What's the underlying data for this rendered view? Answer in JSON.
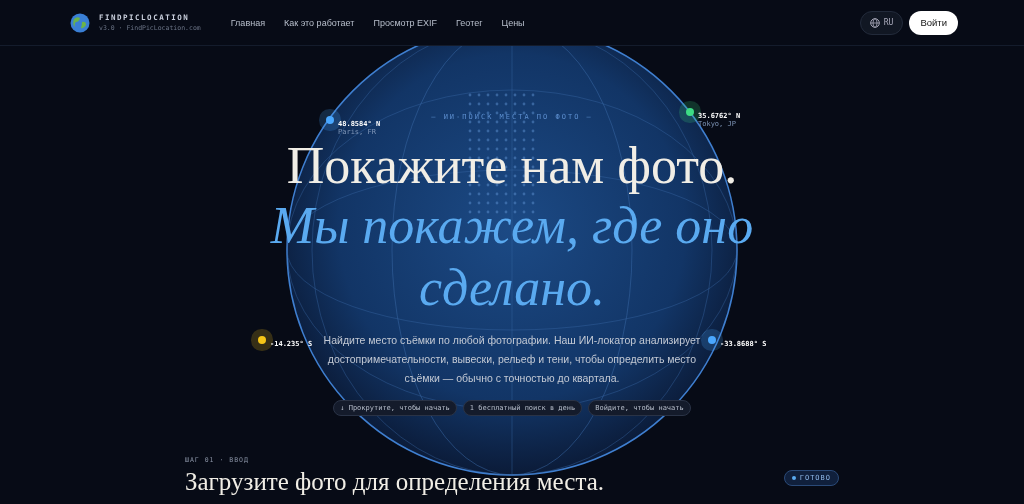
{
  "nav": {
    "brand": "FINDPICLOCATION",
    "version": "v3.0 · FindPicLocation.com",
    "links": [
      {
        "label": "Главная"
      },
      {
        "label": "Как это работает"
      },
      {
        "label": "Просмотр EXIF"
      },
      {
        "label": "Геотег"
      },
      {
        "label": "Цены"
      }
    ],
    "language": "RU",
    "login": "Войти"
  },
  "hero": {
    "eyebrow": "— ИИ-ПОИСК МЕСТА ПО ФОТО —",
    "title": "Покажите нам фото.",
    "title_accent": "Мы покажем, где оно сделано.",
    "description": "Найдите место съёмки по любой фотографии. Наш ИИ-локатор анализирует достопримечательности, вывески, рельеф и тени, чтобы определить место съёмки — обычно с точностью до квартала.",
    "chips": [
      {
        "label": "↓ Прокрутите, чтобы начать"
      },
      {
        "label": "1 бесплатный поиск в день"
      },
      {
        "label": "Войдите, чтобы начать"
      }
    ]
  },
  "globe_markers": [
    {
      "coords": "48.8584° N",
      "place": "Paris, FR",
      "color": "#4aa8ff"
    },
    {
      "coords": "35.6762° N",
      "place": "Tokyo, JP",
      "color": "#3ddc84"
    },
    {
      "coords": "-14.235° S",
      "color": "#f5c518"
    },
    {
      "coords": "-33.8688° S",
      "color": "#4aa8ff"
    }
  ],
  "step": {
    "label": "ШАГ 01 · ВВОД",
    "title": "Загрузите фото для определения места.",
    "status": "ГОТОВО"
  }
}
